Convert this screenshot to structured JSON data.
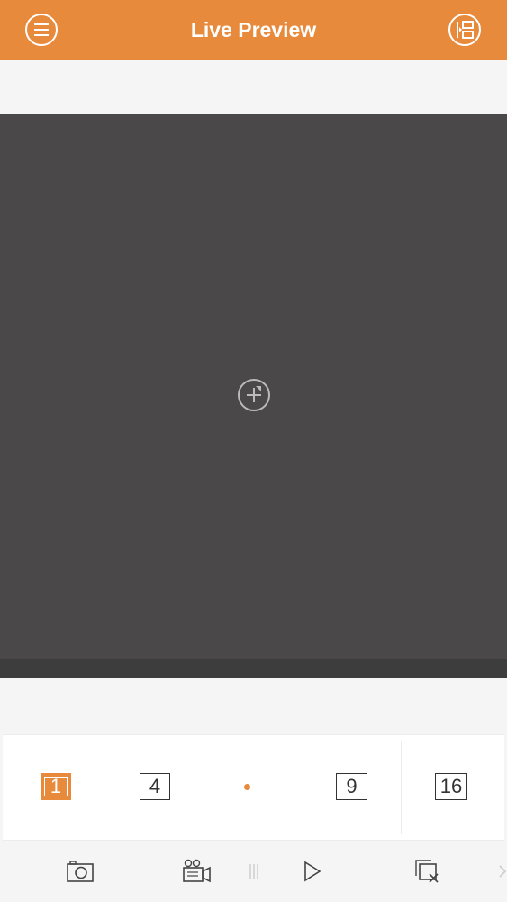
{
  "header": {
    "title": "Live Preview",
    "left_icon": "menu-icon",
    "right_icon": "device-list-icon",
    "accent": "#e88a3c"
  },
  "preview": {
    "add_icon": "add-camera-icon",
    "background": "#4a4848"
  },
  "layout_options": [
    {
      "label": "1",
      "selected": true
    },
    {
      "label": "4",
      "selected": false
    },
    {
      "label": "9",
      "selected": false
    },
    {
      "label": "16",
      "selected": false
    }
  ],
  "pager": {
    "pages": 1,
    "current": 1
  },
  "toolbar": {
    "icons": [
      "camera-icon",
      "record-video-icon",
      "pause-icon",
      "play-icon",
      "close-all-icon",
      "chevron-right-icon"
    ]
  }
}
